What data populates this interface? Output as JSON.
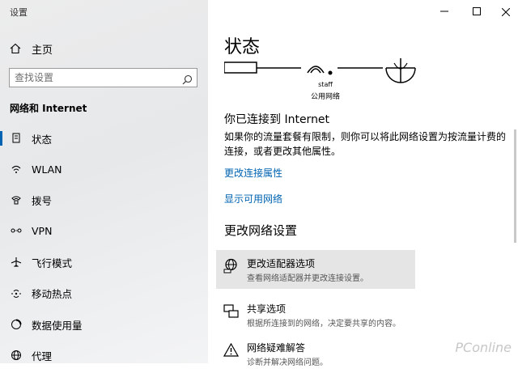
{
  "window": {
    "title": "设置"
  },
  "sidebar": {
    "home_label": "主页",
    "search_placeholder": "查找设置",
    "section_title": "网络和 Internet",
    "items": [
      {
        "label": "状态",
        "icon": "status-icon",
        "active": true
      },
      {
        "label": "WLAN",
        "icon": "wifi-icon",
        "active": false
      },
      {
        "label": "拨号",
        "icon": "dialup-icon",
        "active": false
      },
      {
        "label": "VPN",
        "icon": "vpn-icon",
        "active": false
      },
      {
        "label": "飞行模式",
        "icon": "airplane-icon",
        "active": false
      },
      {
        "label": "移动热点",
        "icon": "hotspot-icon",
        "active": false
      },
      {
        "label": "数据使用量",
        "icon": "data-usage-icon",
        "active": false
      },
      {
        "label": "代理",
        "icon": "globe-icon",
        "active": false
      }
    ]
  },
  "main": {
    "title": "状态",
    "network": {
      "name": "staff",
      "type": "公用网络"
    },
    "status_heading": "你已连接到 Internet",
    "status_description": "如果你的流量套餐有限制，则你可以将此网络设置为按流量计费的连接，或者更改其他属性。",
    "links": [
      "更改连接属性",
      "显示可用网络"
    ],
    "change_heading": "更改网络设置",
    "options": [
      {
        "title": "更改适配器选项",
        "desc": "查看网络适配器并更改连接设置。",
        "icon": "adapter-icon"
      },
      {
        "title": "共享选项",
        "desc": "根据所连接到的网络，决定要共享的内容。",
        "icon": "sharing-icon"
      },
      {
        "title": "网络疑难解答",
        "desc": "诊断并解决网络问题。",
        "icon": "warning-icon"
      }
    ]
  },
  "accent_color": "#0063b1",
  "watermark": "PConline"
}
